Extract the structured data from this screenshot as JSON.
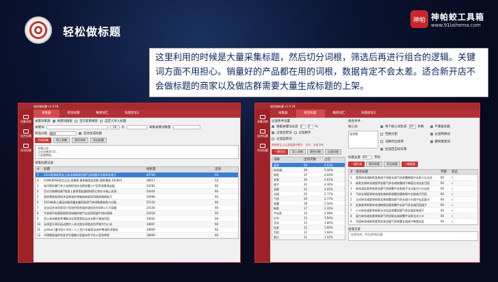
{
  "header": {
    "title": "轻松做标题"
  },
  "brand": {
    "badge": "神帕",
    "title": "神帕蛟工具箱",
    "url": "www.91laihema.com"
  },
  "quote": "这里利用的时候是大量采集标题，然后切分词根，筛选后再进行组合的逻辑。关键词方面不用担心。销量好的产品都在用的词根，数据肯定不会太差。适合新开店不会做标题的商家以及做店群需要大量生成标题的上架。",
  "win1": {
    "title": "轻松做标题 v1.0.18",
    "tabs": [
      "采集器",
      "组合标题",
      "敏感词汇",
      "标题优化2"
    ],
    "side": [
      "采集词库",
      "组合标题",
      "优化标题"
    ],
    "src_label": "关键词来源",
    "opt1": "关键词搜索",
    "opt2": "宝贝类目搜索",
    "opt3": "自定义导入标题",
    "kw_label": "关键词",
    "pages_label": "页",
    "pages_val": "10",
    "kw2_label": "采集关键词数量",
    "cat_label": "商品分类",
    "cat_val": "服装",
    "cat_opt": "自动生成标题",
    "btns": [
      "开始采集",
      "停止采集",
      "清空词库",
      "导出标题"
    ],
    "progress": "采集记录\n正在采集第1页...\n已采集数据...",
    "list_label": "采集标题记录",
    "cols": [
      "#",
      "标题",
      "搜索量",
      "出现"
    ],
    "rows": [
      [
        "1",
        "2023夏装新款女士连衣裙韩版显瘦气质收腰中长款碎花裙子",
        "40760",
        "60"
      ],
      [
        "2",
        "CONVERSE官方正品 经典款 帆布鞋男女同款 高帮潮流 101001",
        "38517",
        "52"
      ],
      [
        "3",
        "现代简约客厅茶几电视柜组合北欧轻奢小户型家具套装岩板",
        "34282",
        "60"
      ],
      [
        "4",
        "百分百纯棉短袖T恤男士夏季宽松圆领纯色打底衫半袖上衣男",
        "34034",
        "60"
      ],
      [
        "5",
        "厨房置物架落地多层微波炉烤箱收纳架家用锅具储物架子",
        "29498",
        "60"
      ],
      [
        "6",
        "2023新款儿童运动鞋男童女童网面透气休闲鞋春秋款小白鞋",
        "25134",
        "60"
      ],
      [
        "7",
        "全自动洗衣机家用小型迷你宿舍租房波轮洗衣机8公斤大容量",
        "24130",
        "60"
      ],
      [
        "8",
        "平底锅不粘锅煎锅家用电磁炉燃气灶适用煎蛋牛排炒菜锅",
        "20218",
        "60"
      ],
      [
        "9",
        "男士休闲裤夏季薄款冰丝直筒宽松运动长裤子潮流百搭",
        "19042",
        "59"
      ],
      [
        "10",
        "无线蓝牙耳机运动跑步入耳式超长续航适用苹果华为小米",
        "18807",
        "60"
      ],
      [
        "11",
        "yellow儿童书包小学生一二三到六年级男女孩护脊减负双肩包",
        "18609",
        "60"
      ],
      [
        "12",
        "不锈钢保温杯男女学生便携大容量水杯子办公室泡茶杯",
        "18600",
        "60"
      ]
    ]
  },
  "win2": {
    "title": "轻松做标题 v1.0.18",
    "tabs": [
      "采集器",
      "组合标题",
      "敏感词汇",
      "标题优化2"
    ],
    "side": [
      "采集词库",
      "组合标题",
      "优化标题"
    ],
    "filter_label": "过滤条件设置",
    "chk1": "根据关键词过滤",
    "chk2": "过滤违禁词",
    "chk3": "过滤数字",
    "chk4": "过滤品牌词",
    "range1": "2",
    "range2": "5",
    "range3": "%",
    "warn": "系统默认以过滤标题中数字、字母、无效字符",
    "gen_label": "组合条件",
    "base_label": "核心词",
    "base_val": "连衣裙",
    "opts": [
      "每个核心词生成",
      "条数",
      "不重复标题",
      "空格分割",
      "过滤特殊词",
      "词根优化排序",
      "删除重复词",
      "生成后自动去重"
    ],
    "count": "10",
    "limit_label": "标题长度",
    "limit_val": "60",
    "unit": "字符",
    "left_btns": [
      "一键切词",
      "导入词根",
      "清空词根",
      "过滤词根"
    ],
    "right_btns": [
      "一键生成",
      "清空标题",
      "导出标题",
      "一键复制"
    ],
    "wcols": [
      "词根",
      "出现次数",
      "占比"
    ],
    "words": [
      [
        "夏季",
        "69",
        "5.63%"
      ],
      [
        "碎花裙",
        "39",
        "5.40%"
      ],
      [
        "新款",
        "35",
        "4.69%"
      ],
      [
        "女装",
        "34",
        "4.61%"
      ],
      [
        "裙子",
        "32",
        "4.36%"
      ],
      [
        "显瘦",
        "22",
        "3.05%"
      ],
      [
        "长裙",
        "20",
        "2.77%"
      ],
      [
        "气质",
        "20",
        "2.77%"
      ],
      [
        "收腰",
        "18",
        "2.50%"
      ],
      [
        "韩版",
        "17",
        "2.35%"
      ],
      [
        "中长款",
        "15",
        "2.08%"
      ],
      [
        "小众",
        "14",
        "1.94%"
      ],
      [
        "法式",
        "13",
        "1.80%"
      ],
      [
        "仙女",
        "12",
        "1.66%"
      ],
      [
        "百搭",
        "12",
        "1.66%"
      ],
      [
        "复古",
        "11",
        "1.52%"
      ]
    ],
    "tcols": [
      "#",
      "组合标题",
      "字数",
      "状态"
    ],
    "titles": [
      [
        "1",
        "夏季碎花裙新款女装裙子显瘦长裙气质收腰韩版中长款小众法式",
        "60",
        "√"
      ],
      [
        "2",
        "新款女装碎花裙夏季显瘦气质长裙收腰裙子韩版法式仙女百搭",
        "60",
        "√"
      ],
      [
        "3",
        "碎花裙女夏季新款显瘦气质收腰中长款裙子法式复古小众仙女",
        "60",
        "√"
      ],
      [
        "4",
        "气质长裙夏季碎花裙女装新款收腰显瘦韩版中长款裙子百搭",
        "60",
        "√"
      ],
      [
        "5",
        "法式碎花裙夏季新款女装收腰显瘦气质长裙小众裙子仙女复古",
        "60",
        "√"
      ],
      [
        "6",
        "女装夏季新款碎花裙韩版显瘦收腰中长款气质长裙百搭裙子",
        "60",
        "√"
      ],
      [
        "7",
        "小众碎花裙夏季新款法式仙女收腰显瘦气质长裙女装裙子",
        "60",
        "√"
      ],
      [
        "8",
        "复古碎花裙女夏季新款气质显瘦长裙收腰中长款法式小众",
        "60",
        "√"
      ],
      [
        "9",
        "百搭碎花裙新款夏季女装显瘦气质收腰长裙裙子韩版仙女",
        "60",
        "√"
      ]
    ],
    "log_label": "处理记录",
    "log": "处理完成，共生成9条标题"
  }
}
